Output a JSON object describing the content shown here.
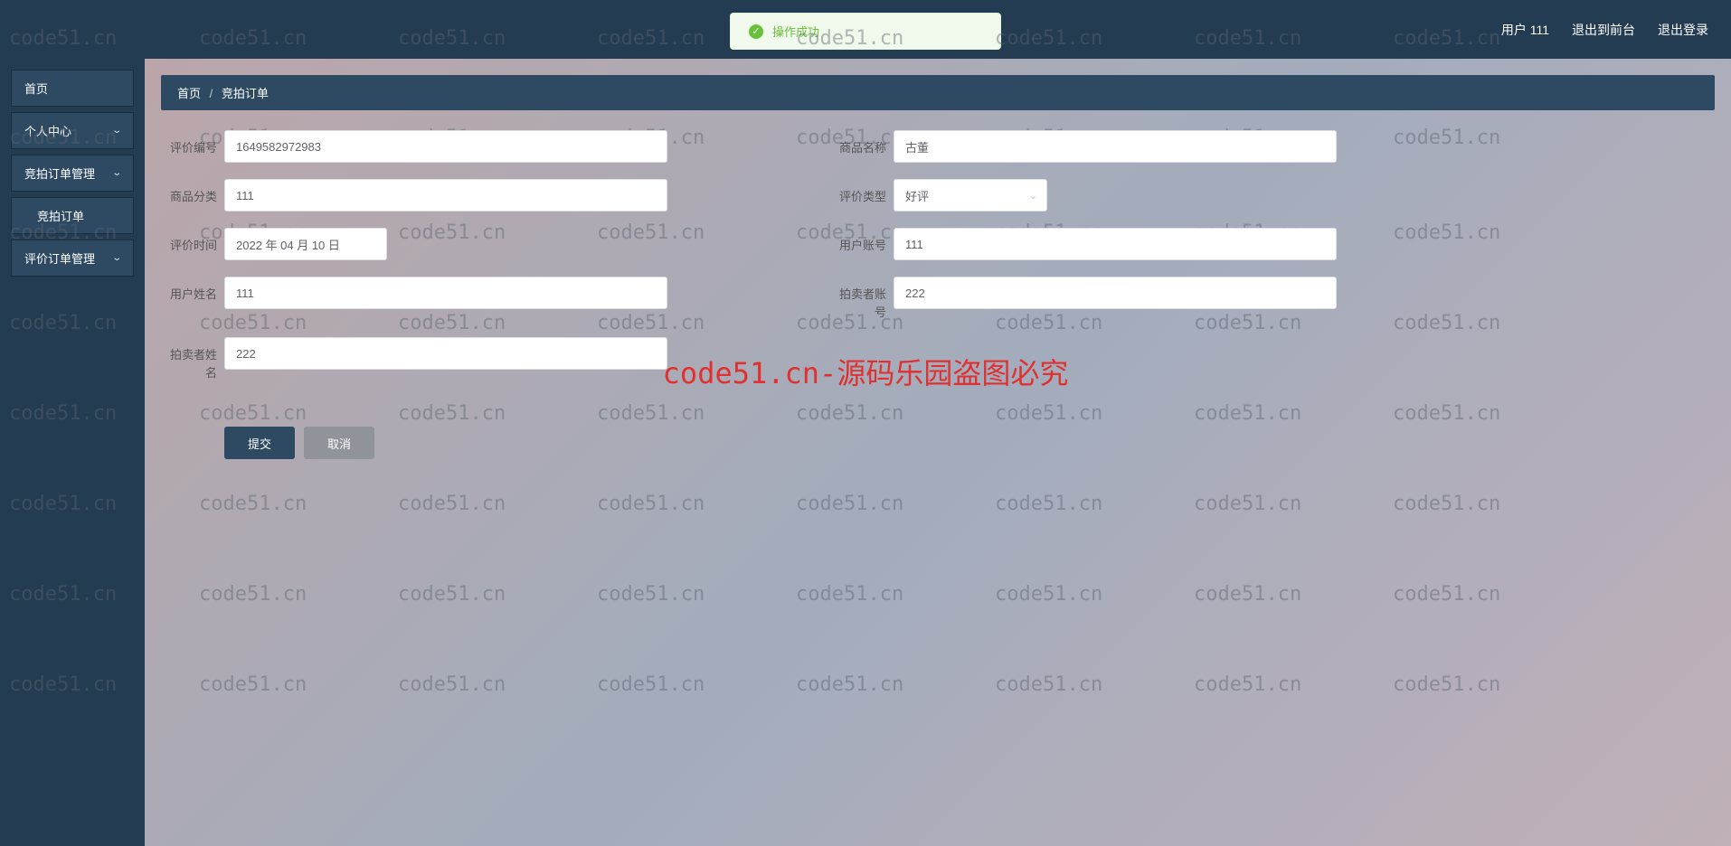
{
  "header": {
    "user_label": "用户 111",
    "back_to_front": "退出到前台",
    "logout": "退出登录"
  },
  "notification": {
    "text": "操作成功"
  },
  "sidebar": {
    "home": "首页",
    "personal_center": "个人中心",
    "auction_order_mgmt": "竞拍订单管理",
    "auction_order": "竞拍订单",
    "review_order_mgmt": "评价订单管理"
  },
  "breadcrumb": {
    "home": "首页",
    "current": "竞拍订单"
  },
  "form": {
    "labels": {
      "review_no": "评价编号",
      "product_name": "商品名称",
      "product_category": "商品分类",
      "review_type": "评价类型",
      "review_time": "评价时间",
      "user_account": "用户账号",
      "user_name": "用户姓名",
      "seller_account": "拍卖者账号",
      "seller_name": "拍卖者姓名"
    },
    "values": {
      "review_no": "1649582972983",
      "product_name": "古董",
      "product_category": "111",
      "review_type": "好评",
      "review_time": "2022 年 04 月 10 日",
      "user_account": "111",
      "user_name": "111",
      "seller_account": "222",
      "seller_name": "222"
    }
  },
  "buttons": {
    "submit": "提交",
    "cancel": "取消"
  },
  "watermark": {
    "text": "code51.cn",
    "center": "code51.cn-源码乐园盗图必究"
  }
}
